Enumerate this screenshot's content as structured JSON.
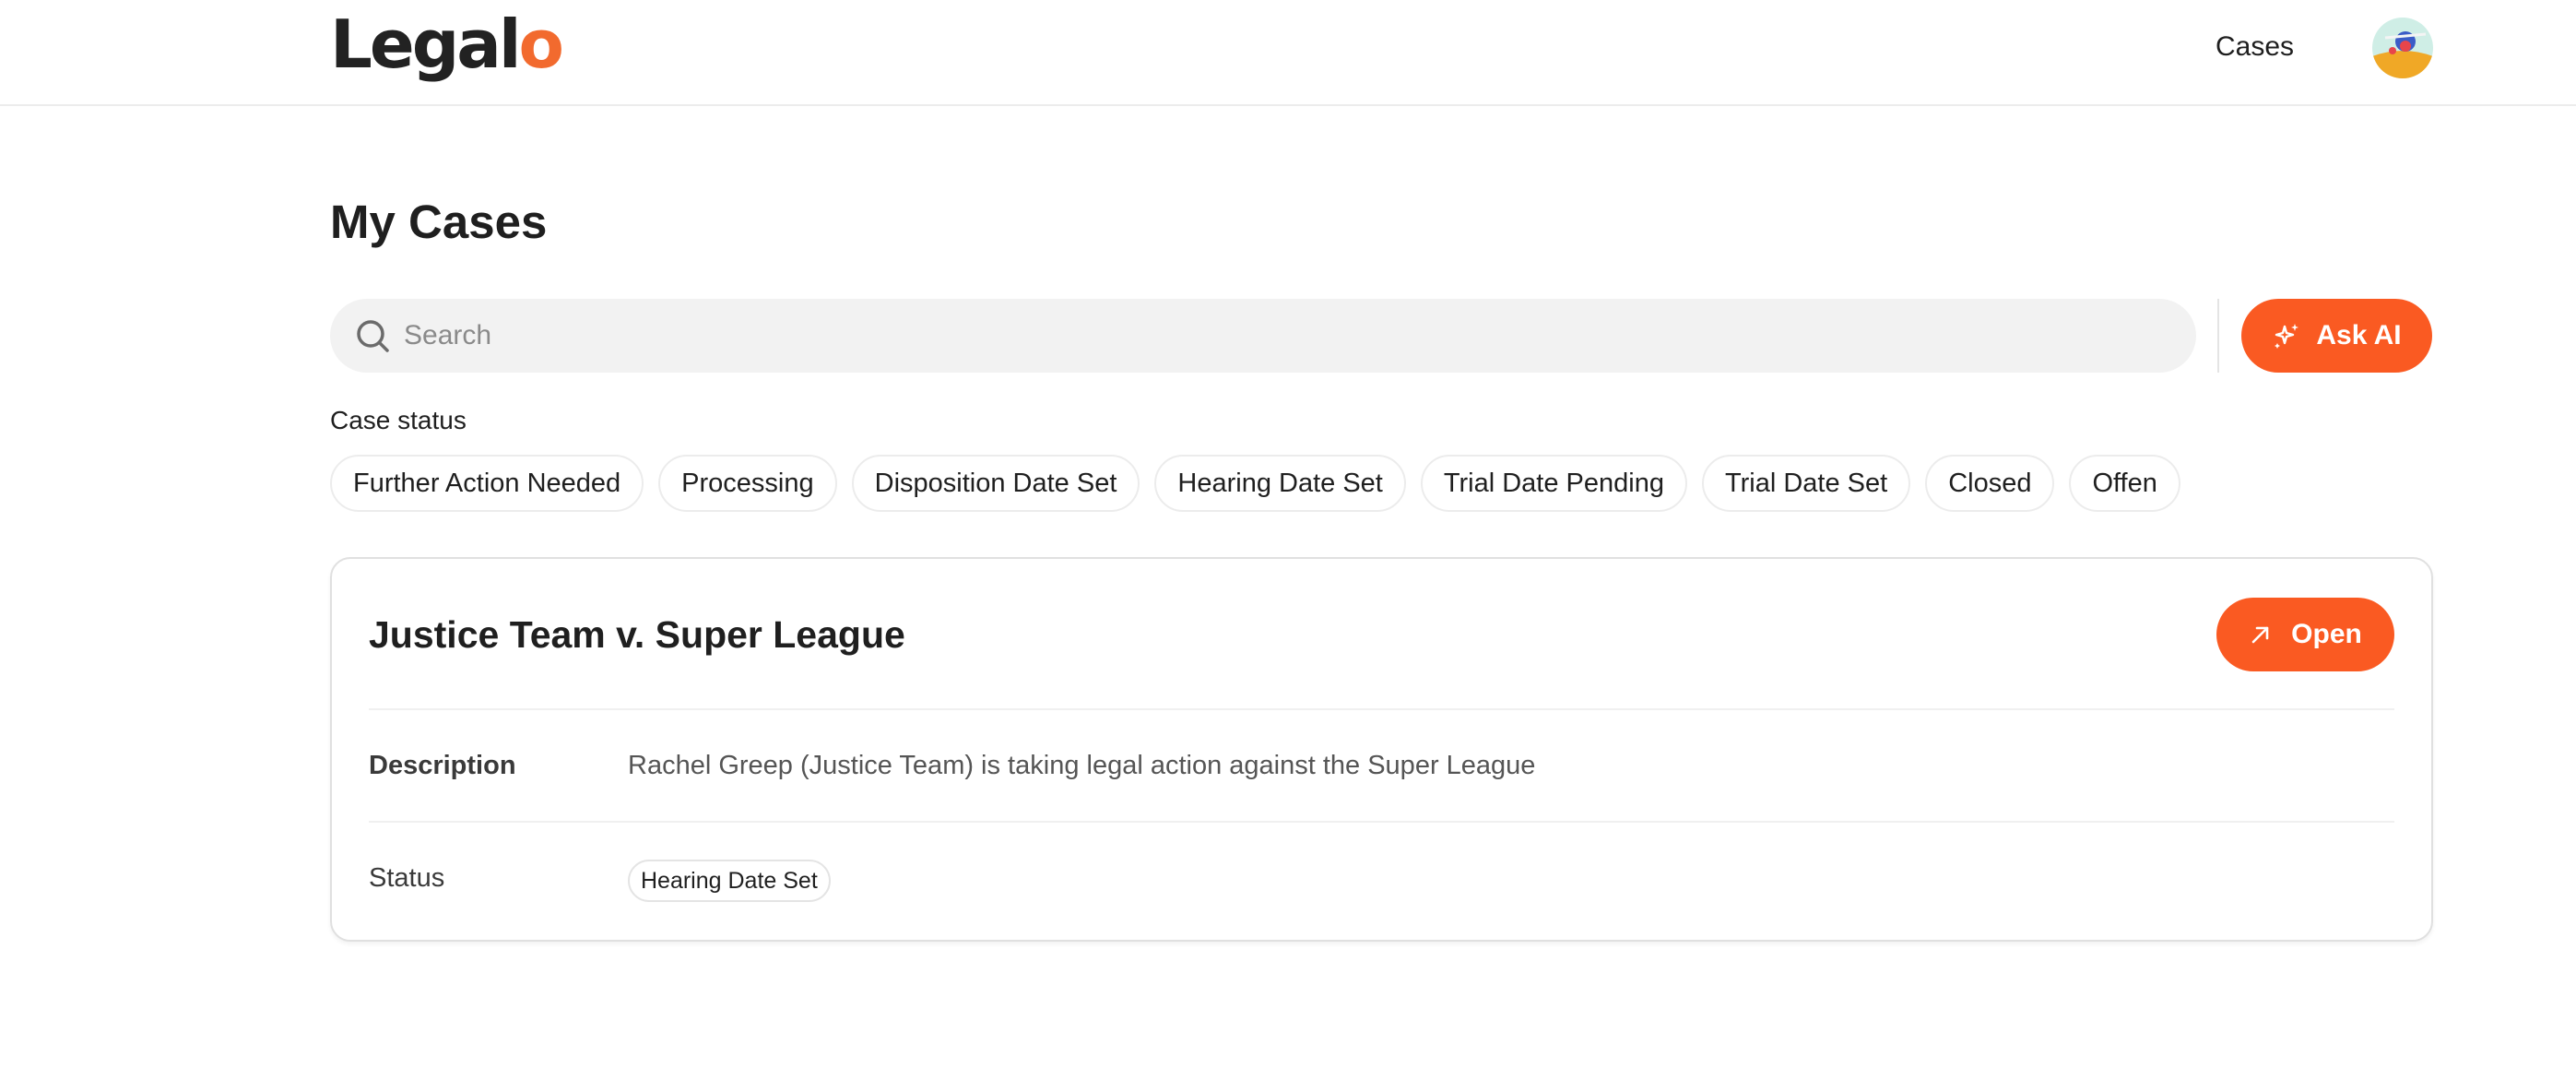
{
  "header": {
    "logo_main": "Legal",
    "logo_accent": "o",
    "nav_cases": "Cases"
  },
  "page": {
    "title": "My Cases"
  },
  "search": {
    "placeholder": "Search",
    "value": ""
  },
  "ask_ai": {
    "label": "Ask AI"
  },
  "filters": {
    "label": "Case status",
    "chips": [
      "Further Action Needed",
      "Processing",
      "Disposition Date Set",
      "Hearing Date Set",
      "Trial Date Pending",
      "Trial Date Set",
      "Closed",
      "Offen"
    ]
  },
  "case": {
    "title": "Justice Team v. Super League",
    "open_label": "Open",
    "description_label": "Description",
    "description": "Rachel Greep (Justice Team) is taking legal action against the Super League",
    "status_label": "Status",
    "status": "Hearing Date Set"
  },
  "colors": {
    "accent": "#fa5a22",
    "logo_accent": "#f26a2e",
    "text": "#1f1f1f",
    "search_bg": "#f2f2f2"
  },
  "icons": {
    "search": "search-icon",
    "ask_ai": "sparkle-icon",
    "open": "arrow-up-right-icon",
    "avatar": "avatar"
  }
}
